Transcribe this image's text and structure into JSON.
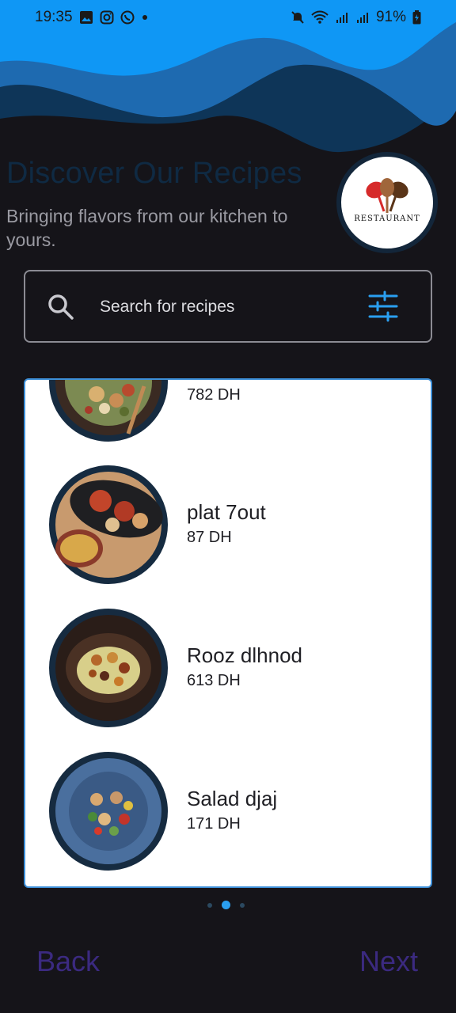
{
  "status_bar": {
    "time": "19:35",
    "left_icons": [
      "gallery-icon",
      "instagram-icon",
      "whatsapp-icon",
      "dot-icon"
    ],
    "right_icons": [
      "mute-icon",
      "wifi-icon",
      "signal-icon",
      "signal-icon",
      "battery-charging-icon"
    ],
    "battery": "91%"
  },
  "header": {
    "title": "Discover Our Recipes",
    "subtitle": "Bringing flavors from our kitchen to yours.",
    "logo_text": "RESTAURANT"
  },
  "search": {
    "placeholder": "Search for recipes"
  },
  "recipes": [
    {
      "name": "",
      "price": "782 DH"
    },
    {
      "name": "plat 7out",
      "price": "87 DH"
    },
    {
      "name": "Rooz dlhnod",
      "price": "613 DH"
    },
    {
      "name": "Salad djaj",
      "price": "171 DH"
    }
  ],
  "pagination": {
    "pages": 3,
    "active": 2
  },
  "nav": {
    "back_label": "Back",
    "next_label": "Next"
  },
  "colors": {
    "background": "#151419",
    "wave_light": "#0f97f5",
    "wave_mid": "#1e6ab0",
    "wave_dark": "#0e3558",
    "accent": "#2a9ff0",
    "nav_text": "#3b2a80",
    "card_border": "#3d8fd8"
  }
}
